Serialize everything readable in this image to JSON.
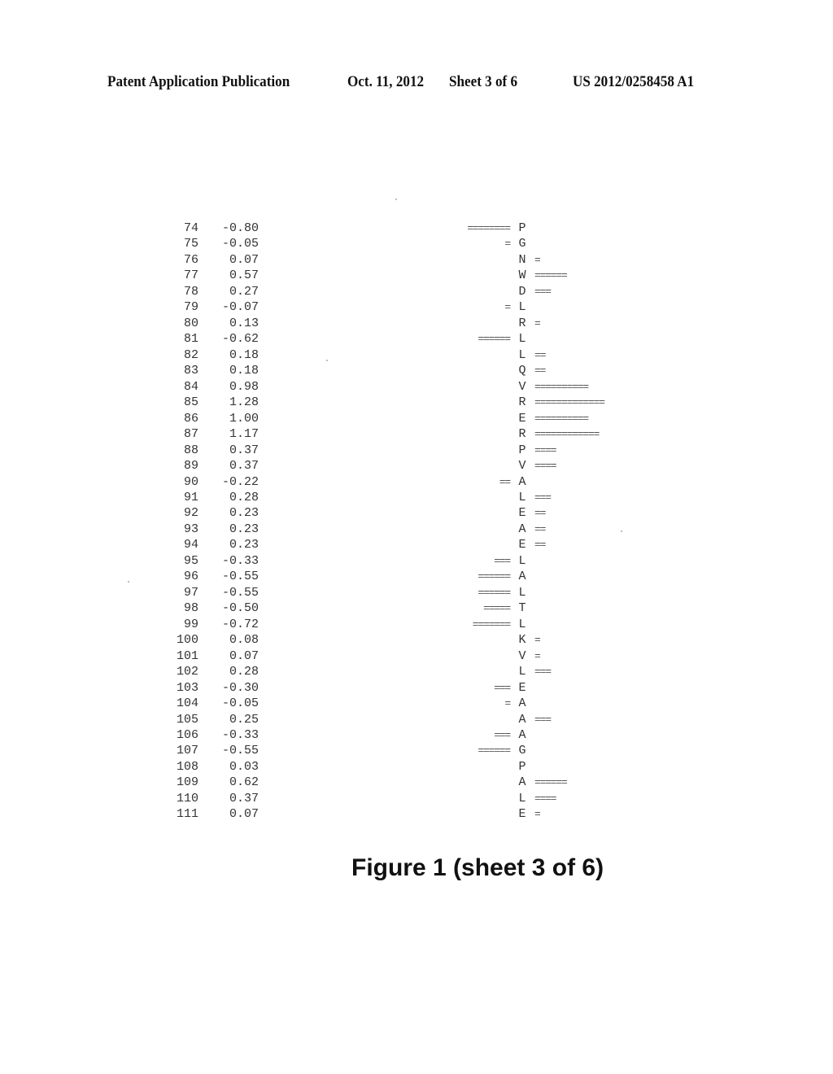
{
  "header": {
    "publication": "Patent Application Publication",
    "date": "Oct. 11, 2012",
    "sheet": "Sheet 3 of 6",
    "patent_number": "US 2012/0258458 A1"
  },
  "bar_char": "=",
  "rows": [
    {
      "index": "74",
      "value": "-0.80",
      "residue": "P"
    },
    {
      "index": "75",
      "value": "-0.05",
      "residue": "G"
    },
    {
      "index": "76",
      "value": "0.07",
      "residue": "N"
    },
    {
      "index": "77",
      "value": "0.57",
      "residue": "W"
    },
    {
      "index": "78",
      "value": "0.27",
      "residue": "D"
    },
    {
      "index": "79",
      "value": "-0.07",
      "residue": "L"
    },
    {
      "index": "80",
      "value": "0.13",
      "residue": "R"
    },
    {
      "index": "81",
      "value": "-0.62",
      "residue": "L"
    },
    {
      "index": "82",
      "value": "0.18",
      "residue": "L"
    },
    {
      "index": "83",
      "value": "0.18",
      "residue": "Q"
    },
    {
      "index": "84",
      "value": "0.98",
      "residue": "V"
    },
    {
      "index": "85",
      "value": "1.28",
      "residue": "R"
    },
    {
      "index": "86",
      "value": "1.00",
      "residue": "E"
    },
    {
      "index": "87",
      "value": "1.17",
      "residue": "R"
    },
    {
      "index": "88",
      "value": "0.37",
      "residue": "P"
    },
    {
      "index": "89",
      "value": "0.37",
      "residue": "V"
    },
    {
      "index": "90",
      "value": "-0.22",
      "residue": "A"
    },
    {
      "index": "91",
      "value": "0.28",
      "residue": "L"
    },
    {
      "index": "92",
      "value": "0.23",
      "residue": "E"
    },
    {
      "index": "93",
      "value": "0.23",
      "residue": "A"
    },
    {
      "index": "94",
      "value": "0.23",
      "residue": "E"
    },
    {
      "index": "95",
      "value": "-0.33",
      "residue": "L"
    },
    {
      "index": "96",
      "value": "-0.55",
      "residue": "A"
    },
    {
      "index": "97",
      "value": "-0.55",
      "residue": "L"
    },
    {
      "index": "98",
      "value": "-0.50",
      "residue": "T"
    },
    {
      "index": "99",
      "value": "-0.72",
      "residue": "L"
    },
    {
      "index": "100",
      "value": "0.08",
      "residue": "K"
    },
    {
      "index": "101",
      "value": "0.07",
      "residue": "V"
    },
    {
      "index": "102",
      "value": "0.28",
      "residue": "L"
    },
    {
      "index": "103",
      "value": "-0.30",
      "residue": "E"
    },
    {
      "index": "104",
      "value": "-0.05",
      "residue": "A"
    },
    {
      "index": "105",
      "value": "0.25",
      "residue": "A"
    },
    {
      "index": "106",
      "value": "-0.33",
      "residue": "A"
    },
    {
      "index": "107",
      "value": "-0.55",
      "residue": "G"
    },
    {
      "index": "108",
      "value": "0.03",
      "residue": "P"
    },
    {
      "index": "109",
      "value": "0.62",
      "residue": "A"
    },
    {
      "index": "110",
      "value": "0.37",
      "residue": "L"
    },
    {
      "index": "111",
      "value": "0.07",
      "residue": "E"
    }
  ],
  "caption": "Figure 1 (sheet 3 of 6)"
}
